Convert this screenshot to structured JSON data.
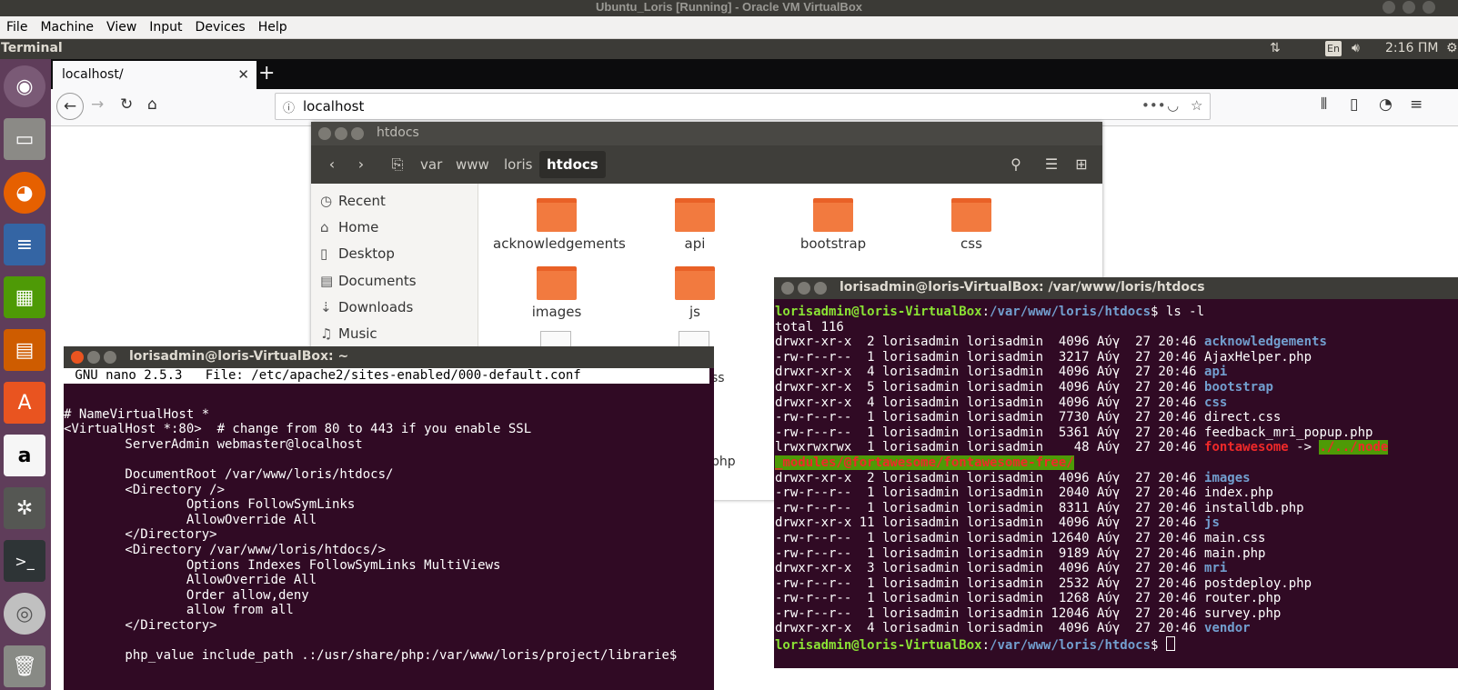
{
  "vbox": {
    "title": "Ubuntu_Loris [Running] - Oracle VM VirtualBox",
    "menu": [
      "File",
      "Machine",
      "View",
      "Input",
      "Devices",
      "Help"
    ]
  },
  "ubuntu_panel": {
    "app_name": "Terminal",
    "lang": "En",
    "clock": "2:16 ΠΜ"
  },
  "launcher": {
    "icons": [
      "ubuntu-dash-icon",
      "files-icon",
      "firefox-icon",
      "writer-icon",
      "calc-icon",
      "impress-icon",
      "software-center-icon",
      "amazon-icon",
      "system-settings-icon",
      "terminal-icon",
      "dvd-icon",
      "trash-icon"
    ]
  },
  "firefox": {
    "tab_title": "localhost/",
    "url": "localhost"
  },
  "nautilus": {
    "title": "htdocs",
    "breadcrumbs": [
      "var",
      "www",
      "loris",
      "htdocs"
    ],
    "sidebar": [
      "Recent",
      "Home",
      "Desktop",
      "Documents",
      "Downloads",
      "Music"
    ],
    "folders": [
      "acknowledgements",
      "api",
      "bootstrap",
      "css",
      "images",
      "js"
    ],
    "partial_labels": [
      "ss",
      "php"
    ]
  },
  "nano_terminal": {
    "title": "lorisadmin@loris-VirtualBox: ~",
    "header": " GNU nano 2.5.3   File: /etc/apache2/sites-enabled/000-default.conf",
    "lines": [
      "",
      "# NameVirtualHost *",
      "<VirtualHost *:80>  # change from 80 to 443 if you enable SSL",
      "        ServerAdmin webmaster@localhost",
      "",
      "        DocumentRoot /var/www/loris/htdocs/",
      "        <Directory />",
      "                Options FollowSymLinks",
      "                AllowOverride All",
      "        </Directory>",
      "        <Directory /var/www/loris/htdocs/>",
      "                Options Indexes FollowSymLinks MultiViews",
      "                AllowOverride All",
      "                Order allow,deny",
      "                allow from all",
      "        </Directory>",
      "",
      "        php_value include_path .:/usr/share/php:/var/www/loris/project/librarie$"
    ]
  },
  "ls_terminal": {
    "title": "lorisadmin@loris-VirtualBox: /var/www/loris/htdocs",
    "prompt_user": "lorisadmin@loris-VirtualBox",
    "prompt_path": "/var/www/loris/htdocs",
    "command": "ls -l",
    "total": "total 116",
    "entries": [
      {
        "meta": "drwxr-xr-x  2 lorisadmin lorisadmin  4096 Αύγ  27 20:46 ",
        "name": "acknowledgements",
        "type": "dir"
      },
      {
        "meta": "-rw-r--r--  1 lorisadmin lorisadmin  3217 Αύγ  27 20:46 ",
        "name": "AjaxHelper.php",
        "type": "file"
      },
      {
        "meta": "drwxr-xr-x  4 lorisadmin lorisadmin  4096 Αύγ  27 20:46 ",
        "name": "api",
        "type": "dir"
      },
      {
        "meta": "drwxr-xr-x  5 lorisadmin lorisadmin  4096 Αύγ  27 20:46 ",
        "name": "bootstrap",
        "type": "dir"
      },
      {
        "meta": "drwxr-xr-x  4 lorisadmin lorisadmin  4096 Αύγ  27 20:46 ",
        "name": "css",
        "type": "dir"
      },
      {
        "meta": "-rw-r--r--  1 lorisadmin lorisadmin  7730 Αύγ  27 20:46 ",
        "name": "direct.css",
        "type": "file"
      },
      {
        "meta": "-rw-r--r--  1 lorisadmin lorisadmin  5361 Αύγ  27 20:46 ",
        "name": "feedback_mri_popup.php",
        "type": "file"
      },
      {
        "meta": "lrwxrwxrwx  1 lorisadmin lorisadmin    48 Αύγ  27 20:46 ",
        "name": "fontawesome",
        "type": "link",
        "arrow": " -> ",
        "target1": "./../node",
        "target2": "_modules/@fortawesome/fontawesome-free/"
      },
      {
        "meta": "drwxr-xr-x  2 lorisadmin lorisadmin  4096 Αύγ  27 20:46 ",
        "name": "images",
        "type": "dir"
      },
      {
        "meta": "-rw-r--r--  1 lorisadmin lorisadmin  2040 Αύγ  27 20:46 ",
        "name": "index.php",
        "type": "file"
      },
      {
        "meta": "-rw-r--r--  1 lorisadmin lorisadmin  8311 Αύγ  27 20:46 ",
        "name": "installdb.php",
        "type": "file"
      },
      {
        "meta": "drwxr-xr-x 11 lorisadmin lorisadmin  4096 Αύγ  27 20:46 ",
        "name": "js",
        "type": "dir"
      },
      {
        "meta": "-rw-r--r--  1 lorisadmin lorisadmin 12640 Αύγ  27 20:46 ",
        "name": "main.css",
        "type": "file"
      },
      {
        "meta": "-rw-r--r--  1 lorisadmin lorisadmin  9189 Αύγ  27 20:46 ",
        "name": "main.php",
        "type": "file"
      },
      {
        "meta": "drwxr-xr-x  3 lorisadmin lorisadmin  4096 Αύγ  27 20:46 ",
        "name": "mri",
        "type": "dir"
      },
      {
        "meta": "-rw-r--r--  1 lorisadmin lorisadmin  2532 Αύγ  27 20:46 ",
        "name": "postdeploy.php",
        "type": "file"
      },
      {
        "meta": "-rw-r--r--  1 lorisadmin lorisadmin  1268 Αύγ  27 20:46 ",
        "name": "router.php",
        "type": "file"
      },
      {
        "meta": "-rw-r--r--  1 lorisadmin lorisadmin 12046 Αύγ  27 20:46 ",
        "name": "survey.php",
        "type": "file"
      },
      {
        "meta": "drwxr-xr-x  4 lorisadmin lorisadmin  4096 Αύγ  27 20:46 ",
        "name": "vendor",
        "type": "dir"
      }
    ]
  },
  "colors": {
    "terminal_bg": "#300a24",
    "prompt_green": "#8ae234",
    "dir_blue": "#729fcf",
    "launcher_bg": "#5f3d5a",
    "folder_orange": "#f27a3f"
  }
}
